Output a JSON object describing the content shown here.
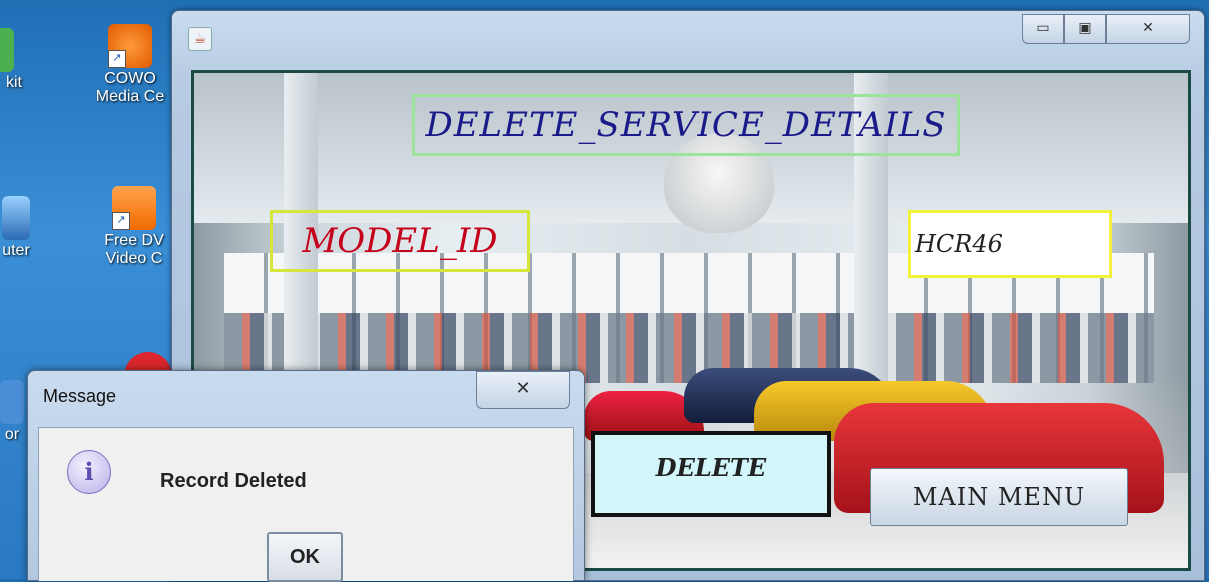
{
  "desktop": {
    "icons": [
      {
        "label_line1": "kit",
        "label_line2": ""
      },
      {
        "label_line1": "COWO",
        "label_line2": "Media Ce"
      },
      {
        "label_line1": "uter",
        "label_line2": ""
      },
      {
        "label_line1": "Free DV",
        "label_line2": "Video C"
      },
      {
        "label_line1": "or",
        "label_line2": ""
      }
    ]
  },
  "window": {
    "controls": {
      "minimize": "▭",
      "maximize": "▣",
      "close": "✕"
    },
    "title_label": "DELETE_SERVICE_DETAILS",
    "model_label": "MODEL_ID",
    "model_value": "HCR46",
    "delete_button": "DELETE",
    "main_menu_button": "MAIN MENU"
  },
  "dialog": {
    "title": "Message",
    "close": "✕",
    "message": "Record Deleted",
    "ok_button": "OK",
    "icon": "info-icon"
  }
}
